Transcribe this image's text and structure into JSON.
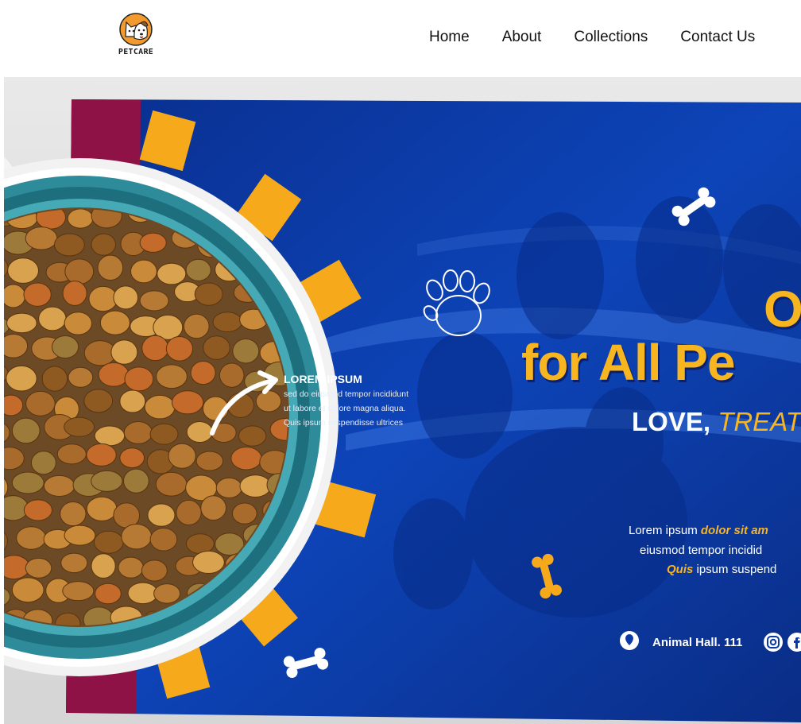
{
  "header": {
    "logo_text": "PETCARE",
    "nav": [
      {
        "label": "Home"
      },
      {
        "label": "About"
      },
      {
        "label": "Collections"
      },
      {
        "label": "Contact Us"
      }
    ]
  },
  "hero": {
    "title_line1": "O",
    "title_line2": "for All Pe",
    "subtitle_part1": "LOVE, ",
    "subtitle_part2": "TREAT",
    "small_heading": "LOREM IPSUM",
    "small_lines": [
      "sed do eiusmod tempor incididunt",
      "ut labore et dolore magna aliqua.",
      "Quis ipsum suspendisse ultrices"
    ],
    "lorem_line1_plain": "Lorem ipsum ",
    "lorem_line1_highlight": "dolor sit am",
    "lorem_line2": "eiusmod tempor incidid",
    "lorem_line3_highlight": "Quis",
    "lorem_line3_plain": " ipsum suspend",
    "address": "Animal Hall. 111",
    "icons": [
      "location-icon",
      "instagram-icon",
      "facebook-icon"
    ]
  },
  "colors": {
    "hero_blue": "#0b3aa8",
    "accent_yellow": "#f7b51f",
    "strip_maroon": "#8f1247",
    "bowl_teal": "#2d8b9a"
  }
}
